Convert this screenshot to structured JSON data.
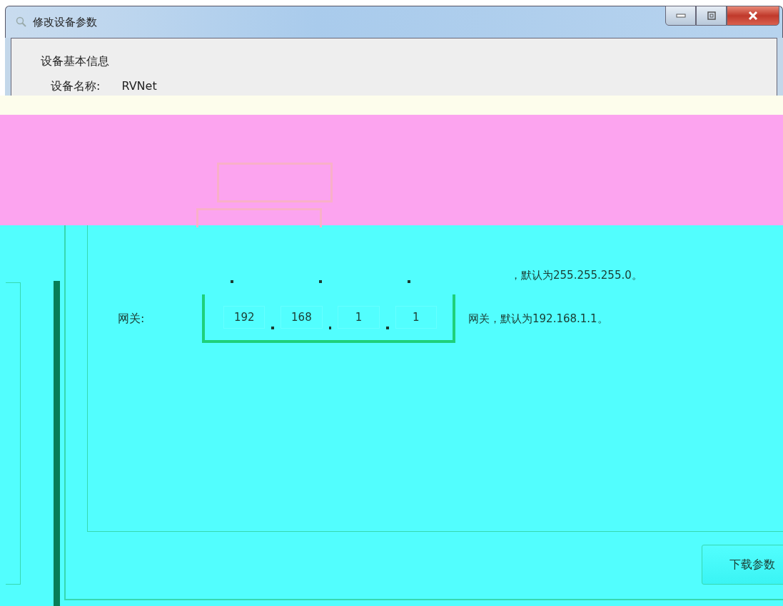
{
  "window": {
    "title": "修改设备参数"
  },
  "device_info": {
    "group_title": "设备基本信息",
    "name_label": "设备名称:",
    "name_value": "RVNet"
  },
  "subnet": {
    "hint": "，默认为255.255.255.0。"
  },
  "gateway": {
    "label": "网关:",
    "octets": [
      "192",
      "168",
      "1",
      "1"
    ],
    "hint": "网关，默认为192.168.1.1。"
  },
  "buttons": [
    {
      "label": "下载参数"
    }
  ]
}
